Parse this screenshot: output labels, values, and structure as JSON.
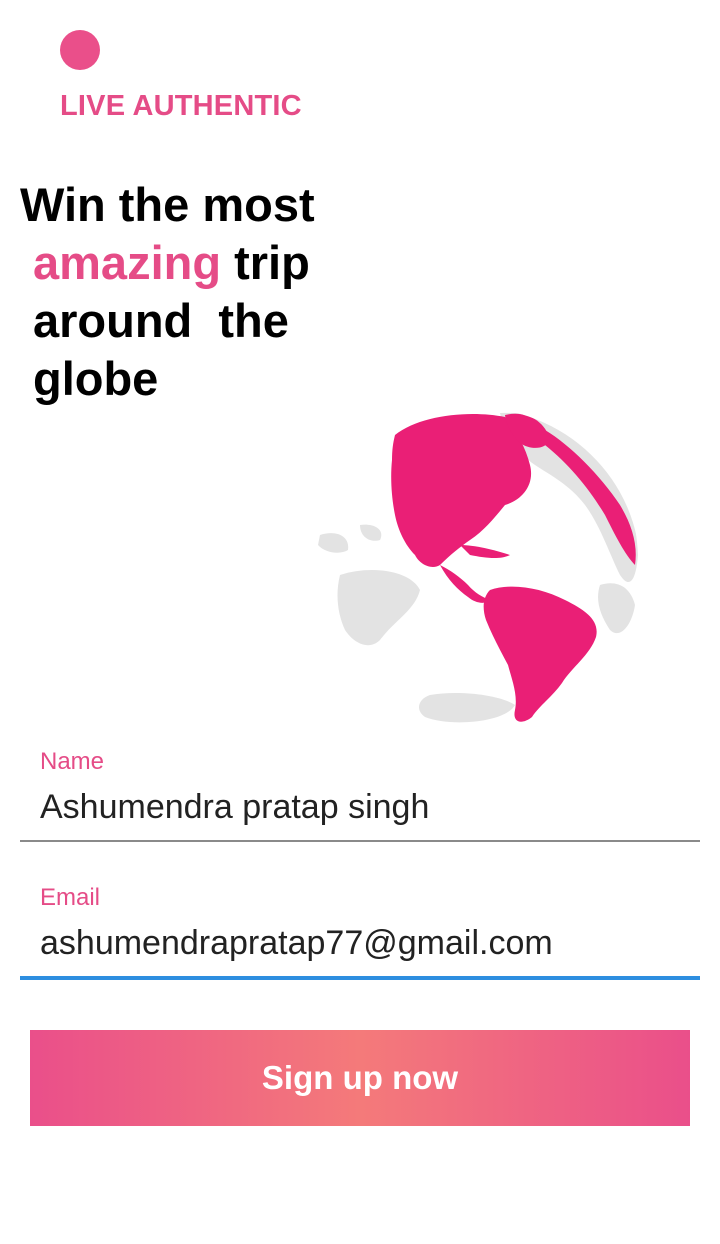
{
  "brand": {
    "name": "LIVE AUTHENTIC",
    "accent_color": "#e54c87"
  },
  "headline": {
    "line1": "Win the most",
    "line2_accent": "amazing",
    "line2_rest": " trip",
    "line3": "around  the",
    "line4": "globe"
  },
  "illustration": {
    "icon": "globe-americas-icon",
    "land_color": "#ea1f76",
    "other_land_color": "#e3e3e3"
  },
  "form": {
    "name": {
      "label": "Name",
      "value": "Ashumendra pratap singh"
    },
    "email": {
      "label": "Email",
      "value": "ashumendrapratap77@gmail.com",
      "focus_color": "#2d8ee0"
    },
    "submit_label": "Sign up now"
  }
}
